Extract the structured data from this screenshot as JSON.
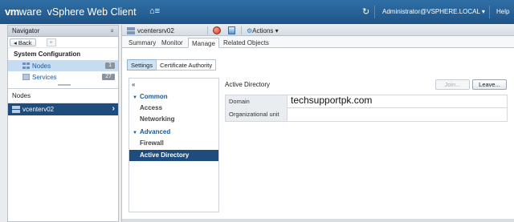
{
  "header": {
    "brand_vm": "vm",
    "brand_ware": "ware",
    "app_title": "vSphere Web Client",
    "user_menu": "Administrator@VSPHERE.LOCAL ▾",
    "help_menu": "Help"
  },
  "navigator": {
    "title": "Navigator",
    "back_label": "◂ Back",
    "section_title": "System Configuration",
    "items": [
      {
        "label": "Nodes",
        "count": "1",
        "icon": "nodes-icon",
        "selected": true
      },
      {
        "label": "Services",
        "count": "27",
        "icon": "services-icon",
        "selected": false
      }
    ],
    "nodes_label": "Nodes",
    "node_item": "vcenterv02"
  },
  "object": {
    "title": "vcentersrv02",
    "actions_label": "Actions ▾"
  },
  "tabs": [
    "Summary",
    "Monitor",
    "Manage",
    "Related Objects"
  ],
  "active_tab": "Manage",
  "subtabs": [
    "Settings",
    "Certificate Authority"
  ],
  "active_subtab": "Settings",
  "settings_nav": {
    "collapse": "«",
    "groups": [
      {
        "label": "Common",
        "items": [
          "Access",
          "Networking"
        ]
      },
      {
        "label": "Advanced",
        "items": [
          "Firewall",
          "Active Directory"
        ]
      }
    ],
    "selected": "Active Directory"
  },
  "content": {
    "title": "Active Directory",
    "join_label": "Join...",
    "leave_label": "Leave...",
    "rows": [
      {
        "key": "Domain",
        "value": "techsupportpk.com"
      },
      {
        "key": "Organizational unit",
        "value": ""
      }
    ]
  },
  "colors": {
    "topbar": "#1f5488",
    "selection": "#1d4c7d",
    "link": "#1a5aa0"
  }
}
